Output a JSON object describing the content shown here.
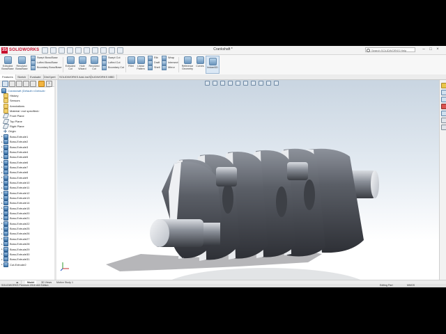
{
  "app": {
    "brand": "SOLIDWORKS",
    "document_title": "Crankshaft *",
    "search_placeholder": "Search SOLIDWORKS Help",
    "window_controls": [
      "‒",
      "□",
      "×"
    ]
  },
  "command_manager": {
    "large_buttons": [
      {
        "label_1": "Extruded",
        "label_2": "Boss/Base",
        "icon": "extruded-boss-icon"
      },
      {
        "label_1": "Revolved",
        "label_2": "Boss/Base",
        "icon": "revolved-boss-icon"
      },
      {
        "label_1": "Extruded",
        "label_2": "Cut",
        "icon": "extruded-cut-icon"
      },
      {
        "label_1": "Hole",
        "label_2": "Wizard",
        "icon": "hole-wizard-icon"
      },
      {
        "label_1": "Revolved",
        "label_2": "Cut",
        "icon": "revolved-cut-icon"
      },
      {
        "label_1": "Fillet",
        "label_2": "",
        "icon": "fillet-icon"
      },
      {
        "label_1": "Linear",
        "label_2": "Pattern",
        "icon": "linear-pattern-icon"
      },
      {
        "label_1": "Reference",
        "label_2": "Geometry",
        "icon": "reference-geometry-icon"
      },
      {
        "label_1": "Curves",
        "label_2": "",
        "icon": "curves-icon"
      },
      {
        "label_1": "Instant3D",
        "label_2": "",
        "icon": "instant3d-icon"
      }
    ],
    "boss_column": [
      "Swept Boss/Base",
      "Lofted Boss/Base",
      "Boundary Boss/Base"
    ],
    "cut_column": [
      "Swept Cut",
      "Lofted Cut",
      "Boundary Cut"
    ],
    "feature_column_1": [
      "Rib",
      "Draft",
      "Shell"
    ],
    "feature_column_2": [
      "Wrap",
      "Intersect",
      "Mirror"
    ]
  },
  "tabs": [
    "Features",
    "Sketch",
    "Evaluate",
    "DimXpert",
    "SOLIDWORKS Add-Ins",
    "SOLIDWORKS MBD"
  ],
  "active_tab": "Features",
  "feature_tree": {
    "root": "Crankshaft (Default<<Default>",
    "items": [
      {
        "label": "History",
        "icon": "folder"
      },
      {
        "label": "Sensors",
        "icon": "folder"
      },
      {
        "label": "Annotations",
        "icon": "folder"
      },
      {
        "label": "Material <not specified>",
        "icon": "folder"
      },
      {
        "label": "Front Plane",
        "icon": "plane"
      },
      {
        "label": "Top Plane",
        "icon": "plane"
      },
      {
        "label": "Right Plane",
        "icon": "plane"
      },
      {
        "label": "Origin",
        "icon": "origin"
      },
      {
        "label": "Boss-Extrude1",
        "icon": "feature"
      },
      {
        "label": "Boss-Extrude2",
        "icon": "feature"
      },
      {
        "label": "Boss-Extrude3",
        "icon": "feature"
      },
      {
        "label": "Boss-Extrude4",
        "icon": "feature"
      },
      {
        "label": "Boss-Extrude5",
        "icon": "feature"
      },
      {
        "label": "Boss-Extrude6",
        "icon": "feature"
      },
      {
        "label": "Boss-Extrude7",
        "icon": "feature"
      },
      {
        "label": "Boss-Extrude8",
        "icon": "feature"
      },
      {
        "label": "Boss-Extrude9",
        "icon": "feature"
      },
      {
        "label": "Boss-Extrude10",
        "icon": "feature"
      },
      {
        "label": "Boss-Extrude11",
        "icon": "feature"
      },
      {
        "label": "Boss-Extrude12",
        "icon": "feature"
      },
      {
        "label": "Boss-Extrude13",
        "icon": "feature"
      },
      {
        "label": "Boss-Extrude14",
        "icon": "feature"
      },
      {
        "label": "Boss-Extrude15",
        "icon": "feature"
      },
      {
        "label": "Boss-Extrude20",
        "icon": "feature"
      },
      {
        "label": "Boss-Extrude21",
        "icon": "feature"
      },
      {
        "label": "Boss-Extrude22",
        "icon": "feature"
      },
      {
        "label": "Boss-Extrude25",
        "icon": "feature"
      },
      {
        "label": "Boss-Extrude26",
        "icon": "feature"
      },
      {
        "label": "Boss-Extrude27",
        "icon": "feature"
      },
      {
        "label": "Boss-Extrude28",
        "icon": "feature"
      },
      {
        "label": "Boss-Extrude29",
        "icon": "feature"
      },
      {
        "label": "Boss-Extrude30",
        "icon": "feature"
      },
      {
        "label": "Boss-Extrude31",
        "icon": "feature"
      },
      {
        "label": "Cut-Extrude2",
        "icon": "feature"
      }
    ]
  },
  "bottom_tabs": [
    "Model",
    "3D Views",
    "Motion Study 1"
  ],
  "status": {
    "left": "SOLIDWORKS Premium 2016 x64 Edition",
    "mode": "Editing Part",
    "units": "MMGS"
  },
  "colors": {
    "accent": "#c8102e",
    "viewport_top": "#c9d5e1",
    "part_steel": "#6b6f78"
  }
}
